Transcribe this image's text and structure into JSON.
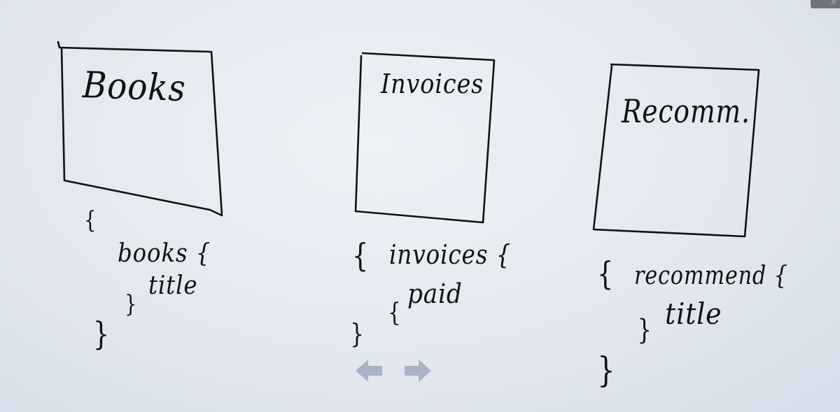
{
  "cards": [
    {
      "title": "Books",
      "query_field": "books {",
      "sub_field": "title"
    },
    {
      "title": "Invoices",
      "query_field": "invoices {",
      "sub_field": "paid"
    },
    {
      "title": "Recomm.",
      "query_field": "recommend {",
      "sub_field": "title"
    }
  ],
  "braces": {
    "open": "{",
    "close": "}"
  },
  "navigation": {
    "prev_icon": "arrow-left-icon",
    "next_icon": "arrow-right-icon",
    "arrow_color": "#a9b4c6"
  },
  "ink_color": "#111111"
}
